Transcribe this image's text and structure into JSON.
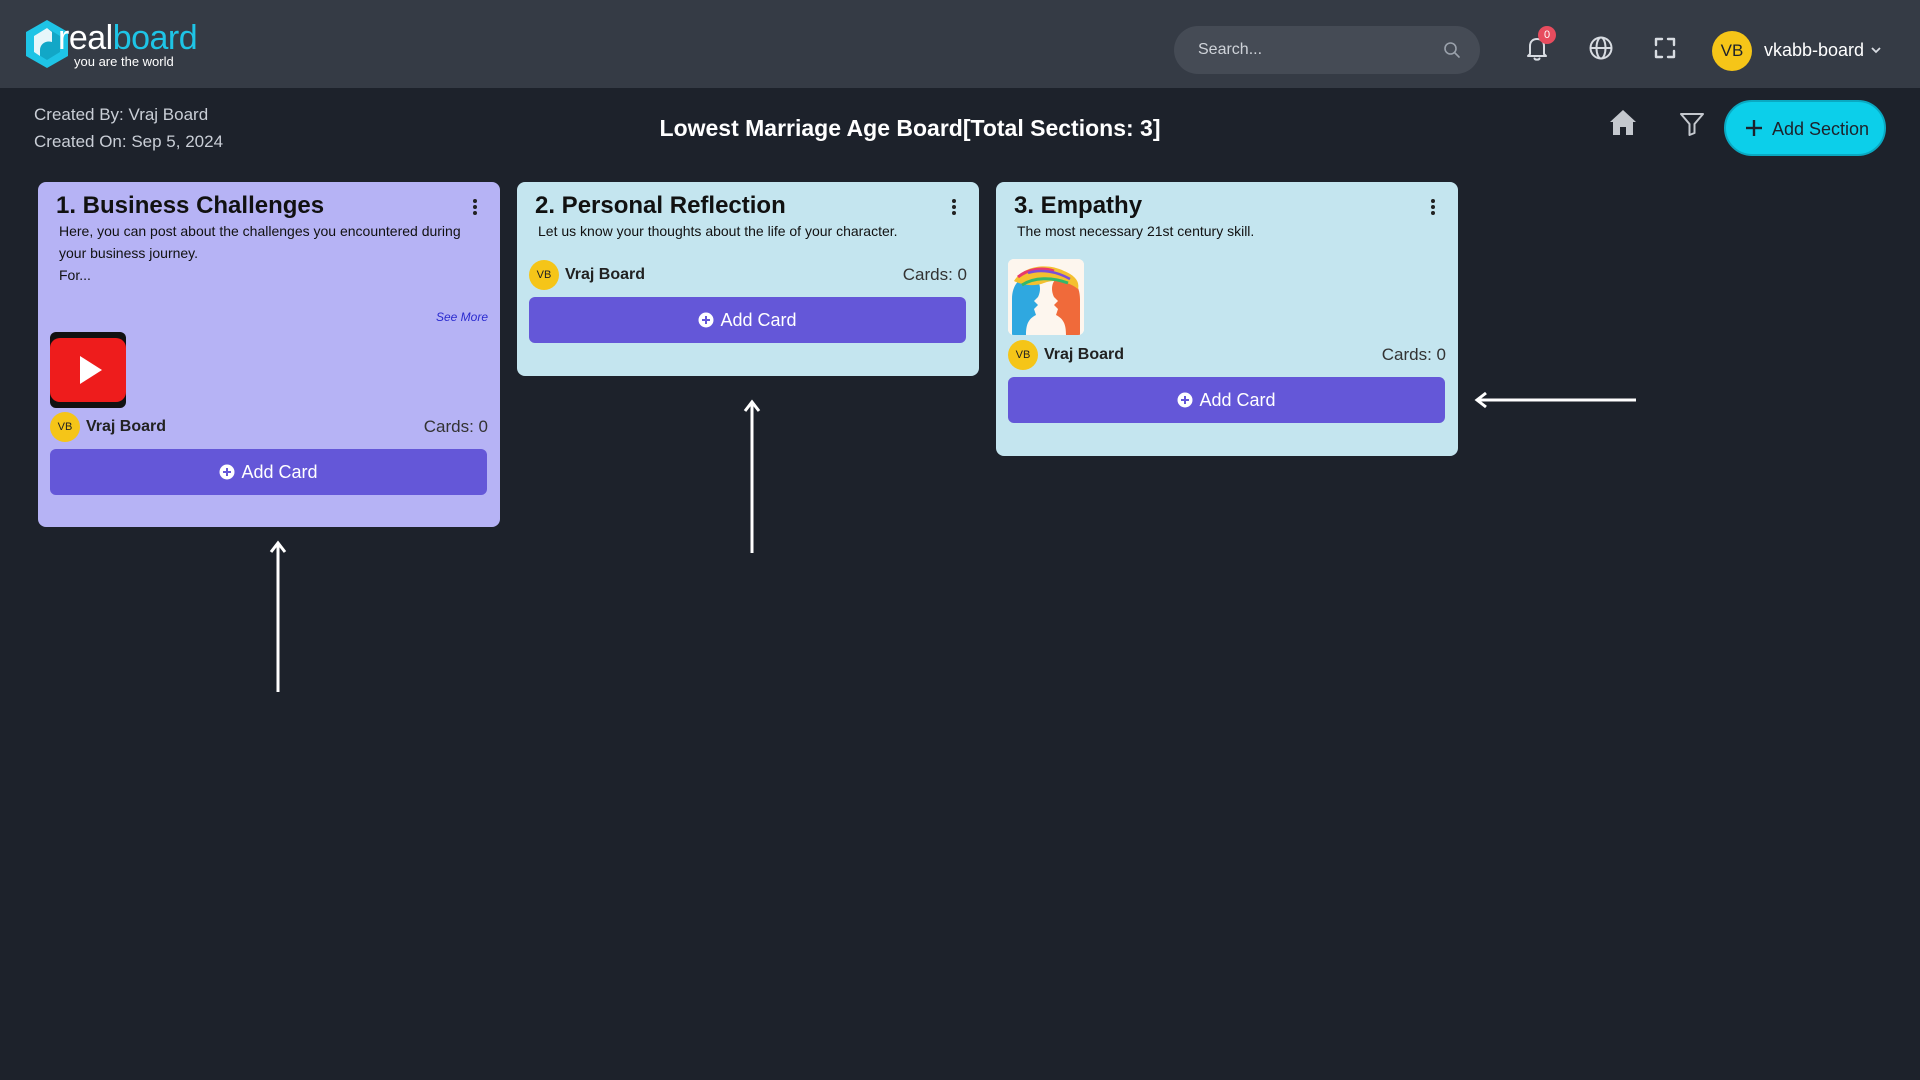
{
  "brand": {
    "word_part1": "real",
    "word_part2": "board",
    "tagline": "you are the world"
  },
  "search": {
    "placeholder": "Search..."
  },
  "notifications": {
    "count": "0"
  },
  "user": {
    "initials": "VB",
    "name": "vkabb-board"
  },
  "board": {
    "created_by": "Created By: Vraj Board",
    "created_on": "Created On: Sep 5, 2024",
    "title": "Lowest Marriage Age Board[Total Sections: 3]",
    "add_section_label": "Add Section"
  },
  "sections": [
    {
      "title": "1. Business Challenges",
      "description": "Here, you can post about the challenges you encountered during your business journey.",
      "description_more": "For...",
      "see_more": "See More",
      "owner_initials": "VB",
      "owner_name": "Vraj Board",
      "cards_count": "Cards: 0",
      "add_card_label": "Add Card",
      "background": "#b6b3f5"
    },
    {
      "title": "2. Personal Reflection",
      "description": "Let us know your thoughts about the life of your character.",
      "owner_initials": "VB",
      "owner_name": "Vraj Board",
      "cards_count": "Cards: 0",
      "add_card_label": "Add Card",
      "background": "#c4e5ef"
    },
    {
      "title": "3. Empathy",
      "description": "The most necessary 21st century skill.",
      "owner_initials": "VB",
      "owner_name": "Vraj Board",
      "cards_count": "Cards: 0",
      "add_card_label": "Add Card",
      "background": "#c4e5ef"
    }
  ],
  "colors": {
    "page_bg": "#1d222b",
    "topbar_bg": "#353b45",
    "accent_cyan": "#0ccfea",
    "add_card_purple": "#6457d8",
    "avatar_yellow": "#f5c518",
    "badge_red": "#e74c5e"
  }
}
